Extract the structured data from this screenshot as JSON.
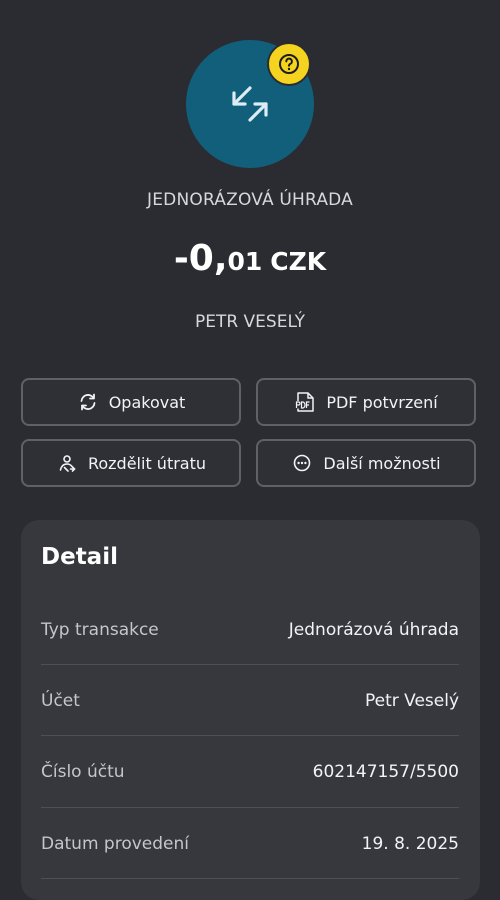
{
  "transaction": {
    "type_label": "JEDNORÁZOVÁ ÚHRADA",
    "amount_integer": "-0,",
    "amount_decimal": "01",
    "currency": "CZK",
    "counterparty": "PETR VESELÝ",
    "status_icon": "question-icon",
    "type_icon": "transfer-arrows-icon"
  },
  "actions": {
    "repeat_label": "Opakovat",
    "pdf_label": "PDF potvrzení",
    "split_label": "Rozdělit útratu",
    "more_label": "Další možnosti"
  },
  "detail": {
    "title": "Detail",
    "rows": [
      {
        "label": "Typ transakce",
        "value": "Jednorázová úhrada"
      },
      {
        "label": "Účet",
        "value": "Petr Veselý"
      },
      {
        "label": "Číslo účtu",
        "value": "602147157/5500"
      },
      {
        "label": "Datum provedení",
        "value": "19. 8. 2025"
      }
    ]
  },
  "colors": {
    "background": "#2a2c31",
    "avatar": "#125f7c",
    "badge": "#f4d41f",
    "card": "#36383d",
    "button_border": "#5e6168"
  }
}
